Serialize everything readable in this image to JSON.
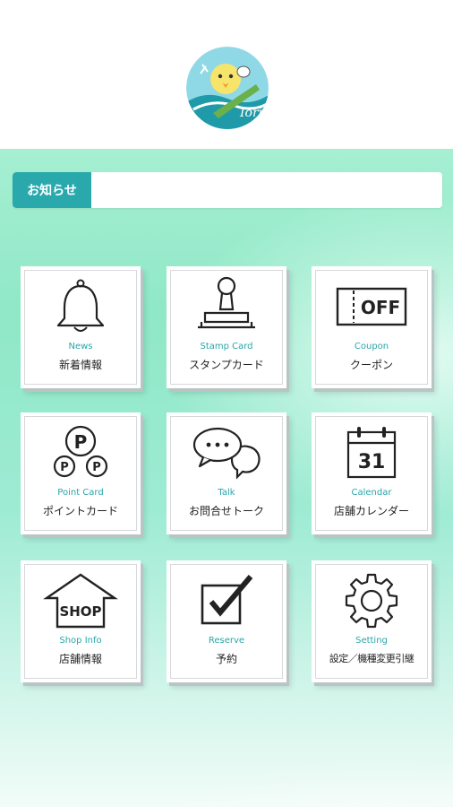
{
  "header": {
    "logo_text": "Iori"
  },
  "notice": {
    "label": "お知らせ",
    "text": ""
  },
  "menu": [
    {
      "en": "News",
      "ja": "新着情報",
      "icon": "bell-icon"
    },
    {
      "en": "Stamp Card",
      "ja": "スタンプカード",
      "icon": "stamp-icon"
    },
    {
      "en": "Coupon",
      "ja": "クーポン",
      "icon": "coupon-icon",
      "icon_text": "OFF"
    },
    {
      "en": "Point Card",
      "ja": "ポイントカード",
      "icon": "point-card-icon",
      "icon_text_big": "P",
      "icon_text_small": "P"
    },
    {
      "en": "Talk",
      "ja": "お問合せトーク",
      "icon": "chat-bubbles-icon"
    },
    {
      "en": "Calendar",
      "ja": "店舗カレンダー",
      "icon": "calendar-icon",
      "icon_text": "31"
    },
    {
      "en": "Shop Info",
      "ja": "店舗情報",
      "icon": "shop-icon",
      "icon_text": "SHOP"
    },
    {
      "en": "Reserve",
      "ja": "予約",
      "icon": "checkbox-icon"
    },
    {
      "en": "Setting",
      "ja": "設定／機種変更引継",
      "icon": "gear-icon"
    }
  ],
  "colors": {
    "accent": "#2aa9ad",
    "menu_en_text": "#2aa5a8",
    "background_top": "#a6efd2",
    "background_bottom": "#f2fcf8"
  }
}
